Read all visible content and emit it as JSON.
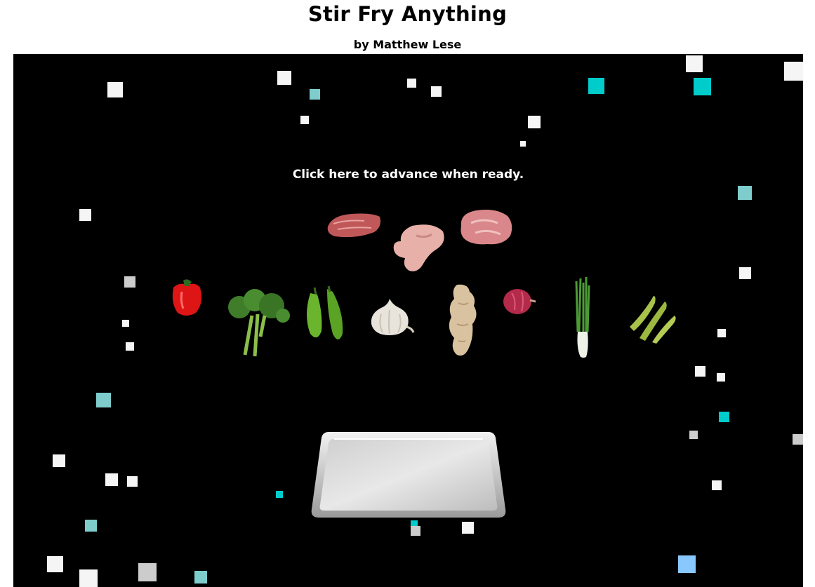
{
  "header": {
    "title": "Stir Fry Anything",
    "byline": "by Matthew Lese"
  },
  "stage": {
    "advance_text": "Click here to advance when ready.",
    "colors": {
      "background": "#000000",
      "square_white": "#f5f5f5",
      "square_cyan": "#00cccc",
      "square_teal": "#7fcccc",
      "square_gray": "#cccccc",
      "square_blue": "#88c8ff"
    }
  },
  "ingredients": {
    "proteins": [
      {
        "name": "beef-steak"
      },
      {
        "name": "chicken-thigh"
      },
      {
        "name": "pork"
      }
    ],
    "vegetables": [
      {
        "name": "red-bell-pepper"
      },
      {
        "name": "broccoli"
      },
      {
        "name": "green-chili-peppers"
      },
      {
        "name": "garlic"
      },
      {
        "name": "ginger"
      },
      {
        "name": "red-onion"
      },
      {
        "name": "green-onion"
      },
      {
        "name": "snow-peas"
      }
    ]
  },
  "tray": {
    "name": "sheet-pan"
  }
}
